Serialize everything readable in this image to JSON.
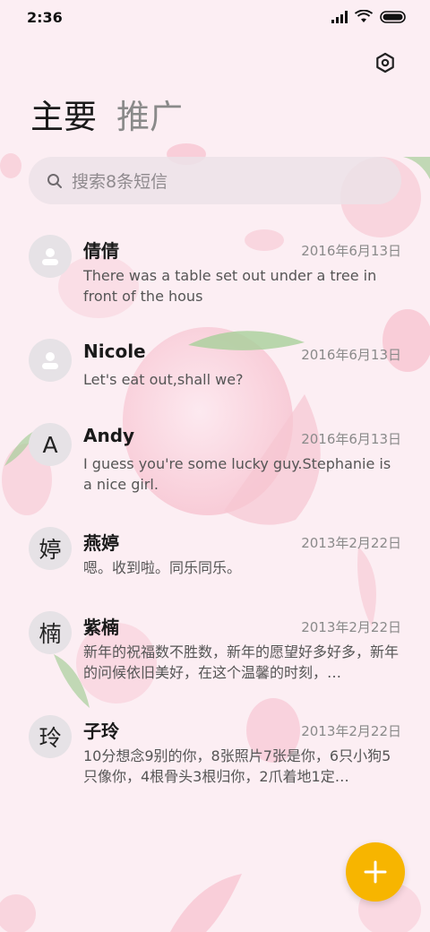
{
  "status_bar": {
    "time": "2:36"
  },
  "tabs": [
    {
      "label": "主要"
    },
    {
      "label": "推广"
    }
  ],
  "search": {
    "placeholder": "搜索8条短信"
  },
  "conversations": [
    {
      "avatar": "",
      "name": "倩倩",
      "date": "2016年6月13日",
      "message": "There was a table set out under a tree in front of the hous"
    },
    {
      "avatar": "",
      "name": "Nicole",
      "date": "2016年6月13日",
      "message": "Let's eat out,shall we?"
    },
    {
      "avatar": "A",
      "name": "Andy",
      "date": "2016年6月13日",
      "message": "I guess you're some lucky guy.Stephanie is a nice girl."
    },
    {
      "avatar": "婷",
      "name": "燕婷",
      "date": "2013年2月22日",
      "message": "嗯。收到啦。同乐同乐。"
    },
    {
      "avatar": "楠",
      "name": "紫楠",
      "date": "2013年2月22日",
      "message": "新年的祝福数不胜数，新年的愿望好多好多，新年的问候依旧美好，在这个温馨的时刻，…"
    },
    {
      "avatar": "玲",
      "name": "子玲",
      "date": "2013年2月22日",
      "message": "10分想念9别的你，8张照片7张是你，6只小狗5只像你，4根骨头3根归你，2爪着地1定…"
    }
  ],
  "icons": {
    "settings": "settings-icon",
    "search": "search-icon",
    "fab": "plus-icon",
    "default_avatar": "person-icon"
  },
  "colors": {
    "accent": "#f7b500",
    "background": "#fceef3"
  }
}
